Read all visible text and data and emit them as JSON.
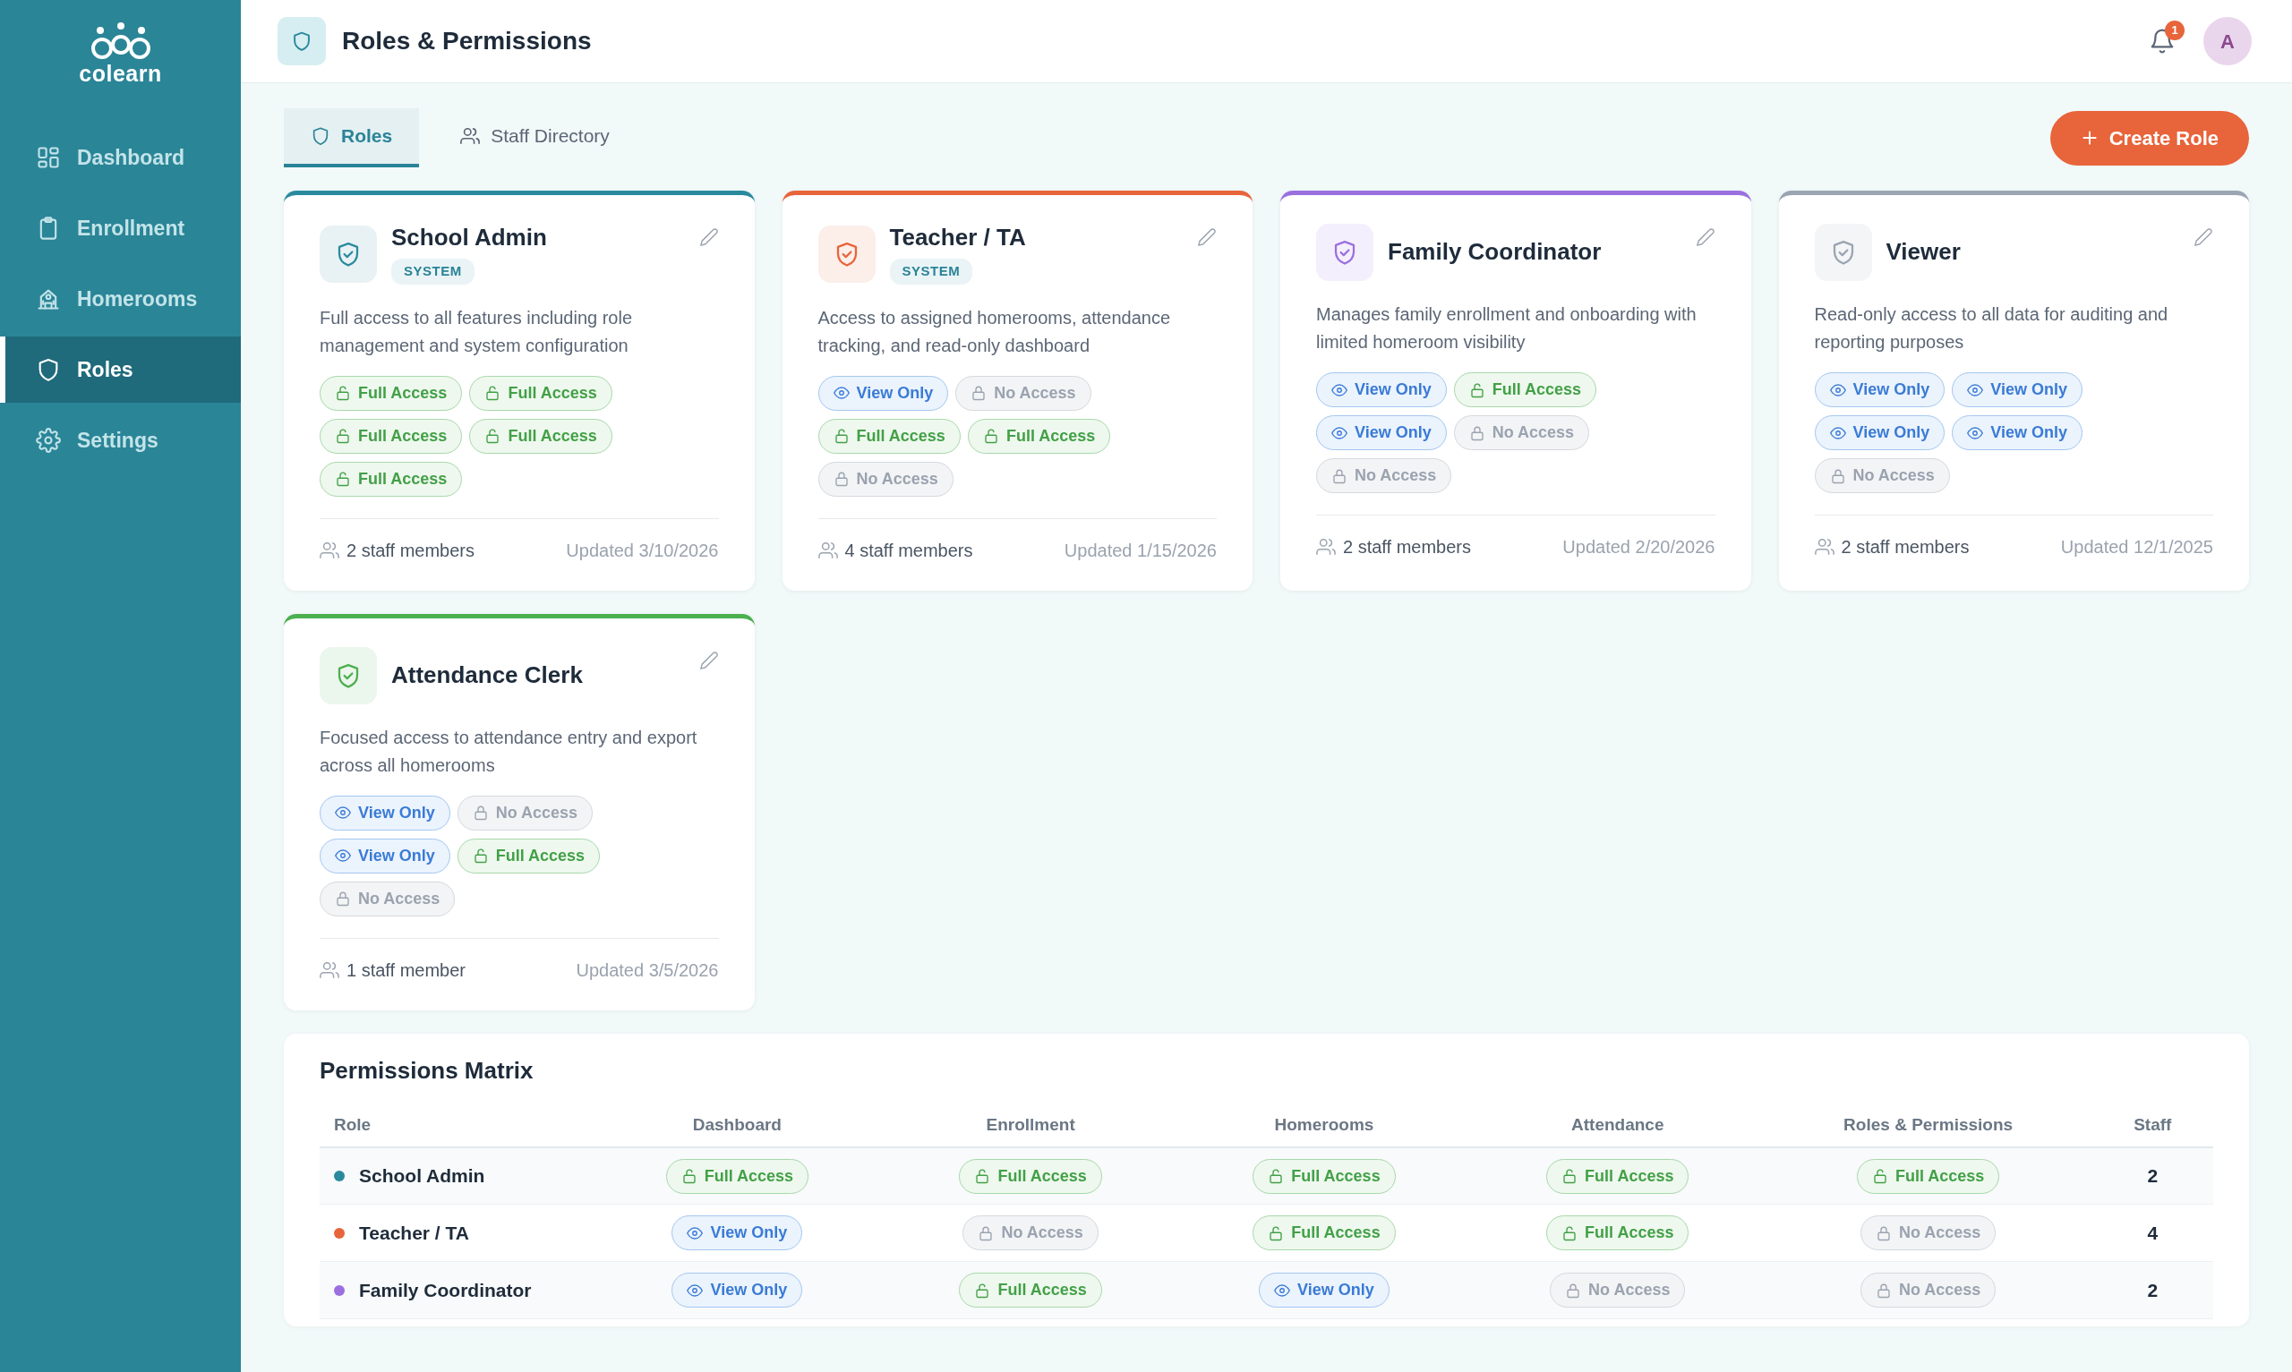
{
  "sidebar": {
    "brand": "colearn",
    "items": [
      {
        "label": "Dashboard",
        "selected": false
      },
      {
        "label": "Enrollment",
        "selected": false
      },
      {
        "label": "Homerooms",
        "selected": false
      },
      {
        "label": "Roles",
        "selected": true
      },
      {
        "label": "Settings",
        "selected": false
      }
    ]
  },
  "header": {
    "title": "Roles & Permissions",
    "notification_count": "1",
    "avatar_initial": "A"
  },
  "tabs": [
    {
      "label": "Roles",
      "selected": true
    },
    {
      "label": "Staff Directory",
      "selected": false
    }
  ],
  "create_button": {
    "label": "Create Role"
  },
  "roles": [
    {
      "name": "School Admin",
      "tag": "SYSTEM",
      "color": "#2a8a9d",
      "description": "Full access to all features including role management and system configuration",
      "permissions": [
        {
          "kind": "full",
          "label": "Full Access"
        },
        {
          "kind": "full",
          "label": "Full Access"
        },
        {
          "kind": "full",
          "label": "Full Access"
        },
        {
          "kind": "full",
          "label": "Full Access"
        },
        {
          "kind": "full",
          "label": "Full Access"
        }
      ],
      "staff": "2 staff members",
      "updated": "Updated 3/10/2026"
    },
    {
      "name": "Teacher / TA",
      "tag": "SYSTEM",
      "color": "#e8643a",
      "description": "Access to assigned homerooms, attendance tracking, and read-only dashboard",
      "permissions": [
        {
          "kind": "view",
          "label": "View Only"
        },
        {
          "kind": "none",
          "label": "No Access"
        },
        {
          "kind": "full",
          "label": "Full Access"
        },
        {
          "kind": "full",
          "label": "Full Access"
        },
        {
          "kind": "none",
          "label": "No Access"
        }
      ],
      "staff": "4 staff members",
      "updated": "Updated 1/15/2026"
    },
    {
      "name": "Family Coordinator",
      "color": "#9b6fe0",
      "description": "Manages family enrollment and onboarding with limited homeroom visibility",
      "permissions": [
        {
          "kind": "view",
          "label": "View Only"
        },
        {
          "kind": "full",
          "label": "Full Access"
        },
        {
          "kind": "view",
          "label": "View Only"
        },
        {
          "kind": "none",
          "label": "No Access"
        },
        {
          "kind": "none",
          "label": "No Access"
        }
      ],
      "staff": "2 staff members",
      "updated": "Updated 2/20/2026"
    },
    {
      "name": "Viewer",
      "color": "#9aa4b2",
      "description": "Read-only access to all data for auditing and reporting purposes",
      "permissions": [
        {
          "kind": "view",
          "label": "View Only"
        },
        {
          "kind": "view",
          "label": "View Only"
        },
        {
          "kind": "view",
          "label": "View Only"
        },
        {
          "kind": "view",
          "label": "View Only"
        },
        {
          "kind": "none",
          "label": "No Access"
        }
      ],
      "staff": "2 staff members",
      "updated": "Updated 12/1/2025"
    },
    {
      "name": "Attendance Clerk",
      "color": "#4caf50",
      "description": "Focused access to attendance entry and export across all homerooms",
      "permissions": [
        {
          "kind": "view",
          "label": "View Only"
        },
        {
          "kind": "none",
          "label": "No Access"
        },
        {
          "kind": "view",
          "label": "View Only"
        },
        {
          "kind": "full",
          "label": "Full Access"
        },
        {
          "kind": "none",
          "label": "No Access"
        }
      ],
      "staff": "1 staff member",
      "updated": "Updated 3/5/2026"
    }
  ],
  "matrix": {
    "title": "Permissions Matrix",
    "columns": [
      "Role",
      "Dashboard",
      "Enrollment",
      "Homerooms",
      "Attendance",
      "Roles & Permissions",
      "Staff"
    ],
    "rows": [
      {
        "role": "School Admin",
        "color": "#2a8a9d",
        "permissions": [
          {
            "kind": "full",
            "label": "Full Access"
          },
          {
            "kind": "full",
            "label": "Full Access"
          },
          {
            "kind": "full",
            "label": "Full Access"
          },
          {
            "kind": "full",
            "label": "Full Access"
          },
          {
            "kind": "full",
            "label": "Full Access"
          }
        ],
        "staff": "2"
      },
      {
        "role": "Teacher / TA",
        "color": "#e8643a",
        "permissions": [
          {
            "kind": "view",
            "label": "View Only"
          },
          {
            "kind": "none",
            "label": "No Access"
          },
          {
            "kind": "full",
            "label": "Full Access"
          },
          {
            "kind": "full",
            "label": "Full Access"
          },
          {
            "kind": "none",
            "label": "No Access"
          }
        ],
        "staff": "4"
      },
      {
        "role": "Family Coordinator",
        "color": "#9b6fe0",
        "permissions": [
          {
            "kind": "view",
            "label": "View Only"
          },
          {
            "kind": "full",
            "label": "Full Access"
          },
          {
            "kind": "view",
            "label": "View Only"
          },
          {
            "kind": "none",
            "label": "No Access"
          },
          {
            "kind": "none",
            "label": "No Access"
          }
        ],
        "staff": "2"
      }
    ]
  }
}
